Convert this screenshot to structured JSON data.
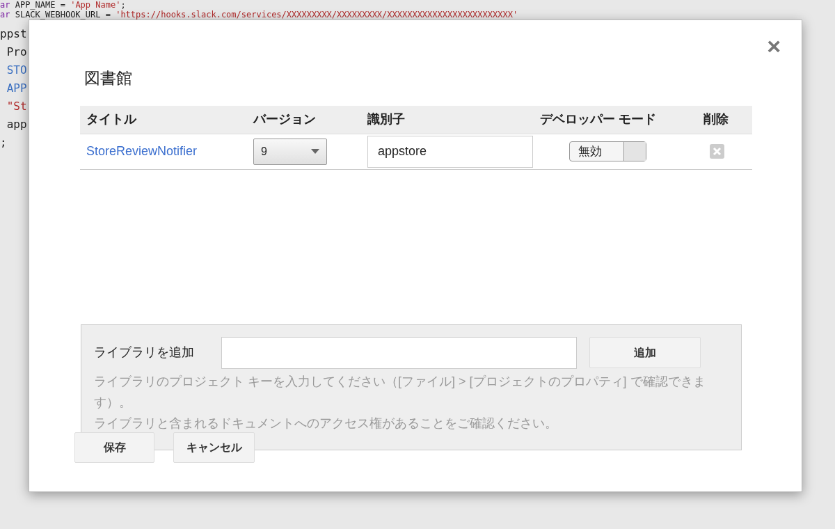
{
  "code_lines": [
    [
      {
        "kind": "keyword",
        "text": "ar"
      },
      {
        "kind": "plain",
        "text": " APP_NAME = "
      },
      {
        "kind": "string",
        "text": "'App Name'"
      },
      {
        "kind": "plain",
        "text": ";"
      }
    ],
    [
      {
        "kind": "keyword",
        "text": "ar"
      },
      {
        "kind": "plain",
        "text": " SLACK_WEBHOOK_URL = "
      },
      {
        "kind": "string",
        "text": "'https://hooks.slack.com/services/XXXXXXXXX/XXXXXXXXX/XXXXXXXXXXXXXXXXXXXXXXXXX'"
      }
    ],
    [
      {
        "kind": "plain",
        "text": "ppst"
      }
    ],
    [
      {
        "kind": "plain",
        "text": " Pro"
      }
    ],
    [
      {
        "kind": "name",
        "text": " STO"
      }
    ],
    [
      {
        "kind": "name",
        "text": " APP"
      }
    ],
    [
      {
        "kind": "string",
        "text": " \"St"
      }
    ],
    [
      {
        "kind": "plain",
        "text": " app"
      }
    ],
    [
      {
        "kind": "plain",
        "text": ";"
      }
    ]
  ],
  "dialog": {
    "close": "×",
    "title": "図書館",
    "table": {
      "columns": [
        "タイトル",
        "バージョン",
        "識別子",
        "デベロッパー モード",
        "削除"
      ],
      "rows": [
        {
          "title": "StoreReviewNotifier",
          "version": "9",
          "identifier": "appstore",
          "dev_mode": {
            "label": "無効",
            "on": false
          }
        }
      ]
    },
    "add_library": {
      "label": "ライブラリを追加",
      "button": "追加",
      "help": [
        "ライブラリのプロジェクト キーを入力してください（[ファイル] > [プロジェクトのプロパティ] で確認できます）。",
        "ライブラリと含まれるドキュメントへのアクセス権があることをご確認ください。"
      ]
    },
    "buttons": [
      "保存",
      "キャンセル"
    ]
  }
}
